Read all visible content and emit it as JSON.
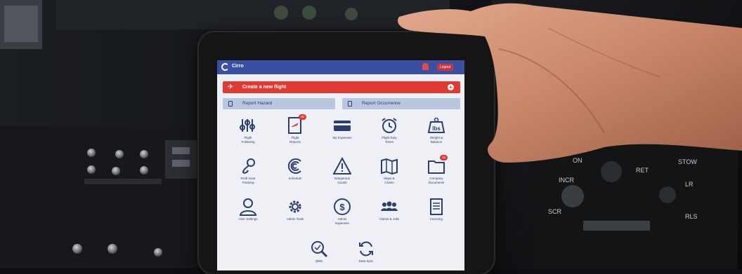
{
  "app": {
    "title": "Cirro",
    "logout_label": "Logout"
  },
  "create_flight": {
    "label": "Create a new flight",
    "icon": "plane-icon"
  },
  "reports": [
    {
      "label": "Report Hazard",
      "icon": "document-icon"
    },
    {
      "label": "Report Occurrence",
      "icon": "document-icon"
    }
  ],
  "grid": [
    {
      "label": "Flight\nFollowing",
      "icon": "sliders-icon"
    },
    {
      "label": "Flight\nReports",
      "icon": "plane-report-icon",
      "badge": "20"
    },
    {
      "label": "My Expenses",
      "icon": "credit-card-icon"
    },
    {
      "label": "Flight Duty\nTimes",
      "icon": "alarm-clock-icon"
    },
    {
      "label": "Weight &\nBalance",
      "icon": "weight-icon",
      "icon_text": "lbs"
    },
    {
      "label": "Field Gear\nTracking",
      "icon": "hook-icon"
    },
    {
      "label": "Schedule",
      "icon": "schedule-icon"
    },
    {
      "label": "Dangerous\nGoods",
      "icon": "warning-icon"
    },
    {
      "label": "Maps &\nCharts",
      "icon": "map-icon"
    },
    {
      "label": "Company\nDocuments",
      "icon": "folder-icon",
      "badge": "16"
    },
    {
      "label": "User Settings",
      "icon": "user-icon"
    },
    {
      "label": "Admin Tools",
      "icon": "gear-icon"
    },
    {
      "label": "Admin\nExpenses",
      "icon": "dollar-icon",
      "icon_text": "$"
    },
    {
      "label": "Clients & Jobs",
      "icon": "group-icon"
    },
    {
      "label": "Invoicing",
      "icon": "invoice-icon"
    },
    {
      "label": "QMS",
      "icon": "magnifier-icon"
    },
    {
      "label": "Data Sync",
      "icon": "sync-icon"
    }
  ],
  "colors": {
    "brand": "#3a4fa2",
    "accent": "#e03a32",
    "icon": "#2c3e6b"
  }
}
